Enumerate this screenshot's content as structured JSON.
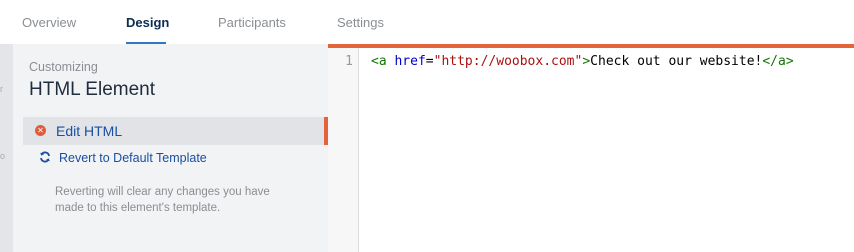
{
  "tabs": [
    {
      "label": "Overview"
    },
    {
      "label": "Design",
      "active": true
    },
    {
      "label": "Participants"
    },
    {
      "label": "Settings"
    }
  ],
  "sidebar": {
    "eyebrow": "Customizing",
    "title": "HTML Element",
    "edit_label": "Edit HTML",
    "edit_icon": "close-icon",
    "revert_label": "Revert to Default Template",
    "revert_icon": "refresh-icon",
    "note": "Reverting will clear any changes you have made to this element's template."
  },
  "editor": {
    "line_number": "1",
    "tokens": {
      "open_tag": "<a",
      "attr_name": " href",
      "equals": "=",
      "attr_value": "\"http://woobox.com\"",
      "open_close": ">",
      "text": "Check out our website!",
      "close_tag": "</a>"
    }
  },
  "colors": {
    "accent": "#e3643a",
    "link": "#1b4fa0",
    "tab_active": "#0d2c52",
    "tab_underline": "#2f78c4"
  }
}
